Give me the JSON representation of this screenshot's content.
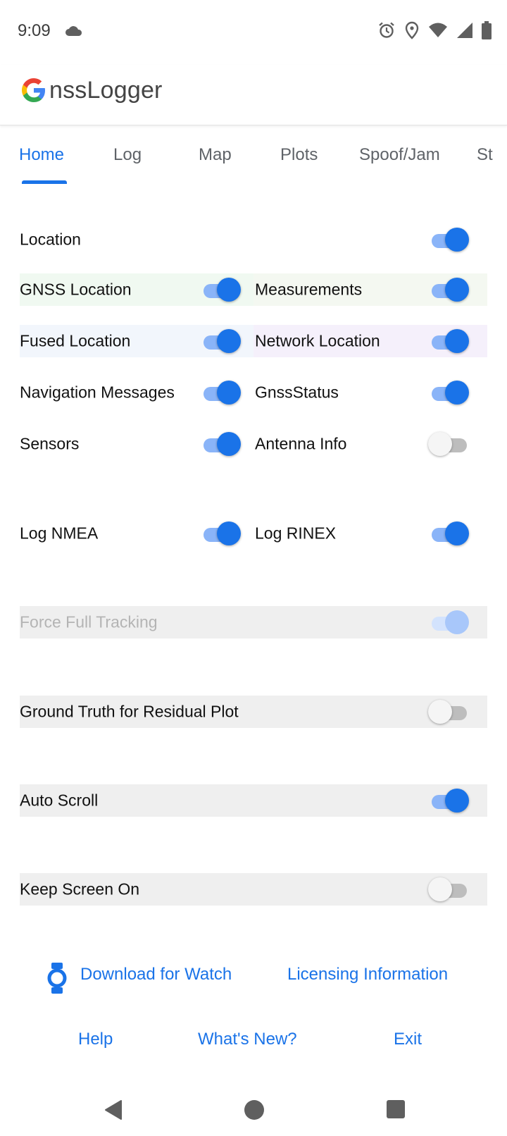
{
  "status_bar": {
    "time": "9:09",
    "icons": [
      "cloud-icon",
      "alarm-icon",
      "location-pin-icon",
      "wifi-icon",
      "cell-signal-icon",
      "battery-icon"
    ]
  },
  "app": {
    "title_letter": "G",
    "title_rest": "nssLogger",
    "logo_colors": [
      "#ea4335",
      "#fbbc05",
      "#34a853",
      "#4285f4"
    ]
  },
  "tabs": [
    {
      "label": "Home",
      "active": true
    },
    {
      "label": "Log",
      "active": false
    },
    {
      "label": "Map",
      "active": false
    },
    {
      "label": "Plots",
      "active": false
    },
    {
      "label": "Spoof/Jam",
      "active": false
    },
    {
      "label": "St",
      "active": false
    }
  ],
  "settings": {
    "location": {
      "label": "Location",
      "on": true
    },
    "gnss_location": {
      "label": "GNSS Location",
      "on": true
    },
    "measurements": {
      "label": "Measurements",
      "on": true
    },
    "fused_location": {
      "label": "Fused Location",
      "on": true
    },
    "network_location": {
      "label": "Network Location",
      "on": true
    },
    "navigation_messages": {
      "label": "Navigation Messages",
      "on": true
    },
    "gnss_status": {
      "label": "GnssStatus",
      "on": true
    },
    "sensors": {
      "label": "Sensors",
      "on": true
    },
    "antenna_info": {
      "label": "Antenna Info",
      "on": false
    },
    "log_nmea": {
      "label": "Log NMEA",
      "on": true
    },
    "log_rinex": {
      "label": "Log RINEX",
      "on": true
    },
    "force_full_tracking": {
      "label": "Force Full Tracking",
      "on": true,
      "enabled": false
    },
    "ground_truth": {
      "label": "Ground Truth for Residual Plot",
      "on": false
    },
    "auto_scroll": {
      "label": "Auto Scroll",
      "on": true
    },
    "keep_screen_on": {
      "label": "Keep Screen On",
      "on": false
    }
  },
  "row_colors": {
    "gnss_location": "#f0f9f1",
    "measurements": "#f4f8f1",
    "fused_location": "#f2f6fc",
    "network_location": "#f5f0fb",
    "shaded": "#efefef"
  },
  "links": {
    "download_watch": "Download for Watch",
    "licensing": "Licensing Information",
    "help": "Help",
    "whats_new": "What's New?",
    "exit": "Exit"
  },
  "accent_color": "#1a73e8"
}
